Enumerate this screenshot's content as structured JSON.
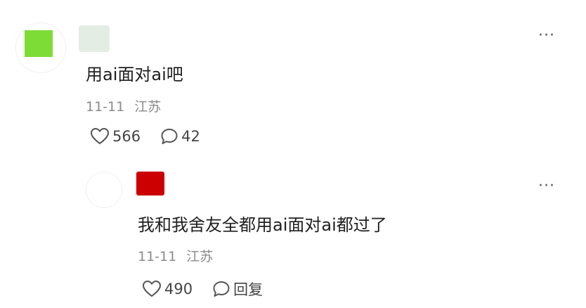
{
  "comments": [
    {
      "avatar_color": "#7ddc36",
      "username_mask_color": "#e4ede4",
      "text": "用ai面对ai吧",
      "date": "11-11",
      "location": "江苏",
      "likes": "566",
      "replies": "42",
      "more_label": "···"
    },
    {
      "avatar_color": "#ffffff",
      "username_mask_color": "#cc0000",
      "text": "我和我舍友全都用ai面对ai都过了",
      "date": "11-11",
      "location": "江苏",
      "likes": "490",
      "reply_label": "回复",
      "more_label": "···"
    }
  ],
  "icons": {
    "like": "heart-outline-icon",
    "comment": "speech-bubble-icon"
  }
}
